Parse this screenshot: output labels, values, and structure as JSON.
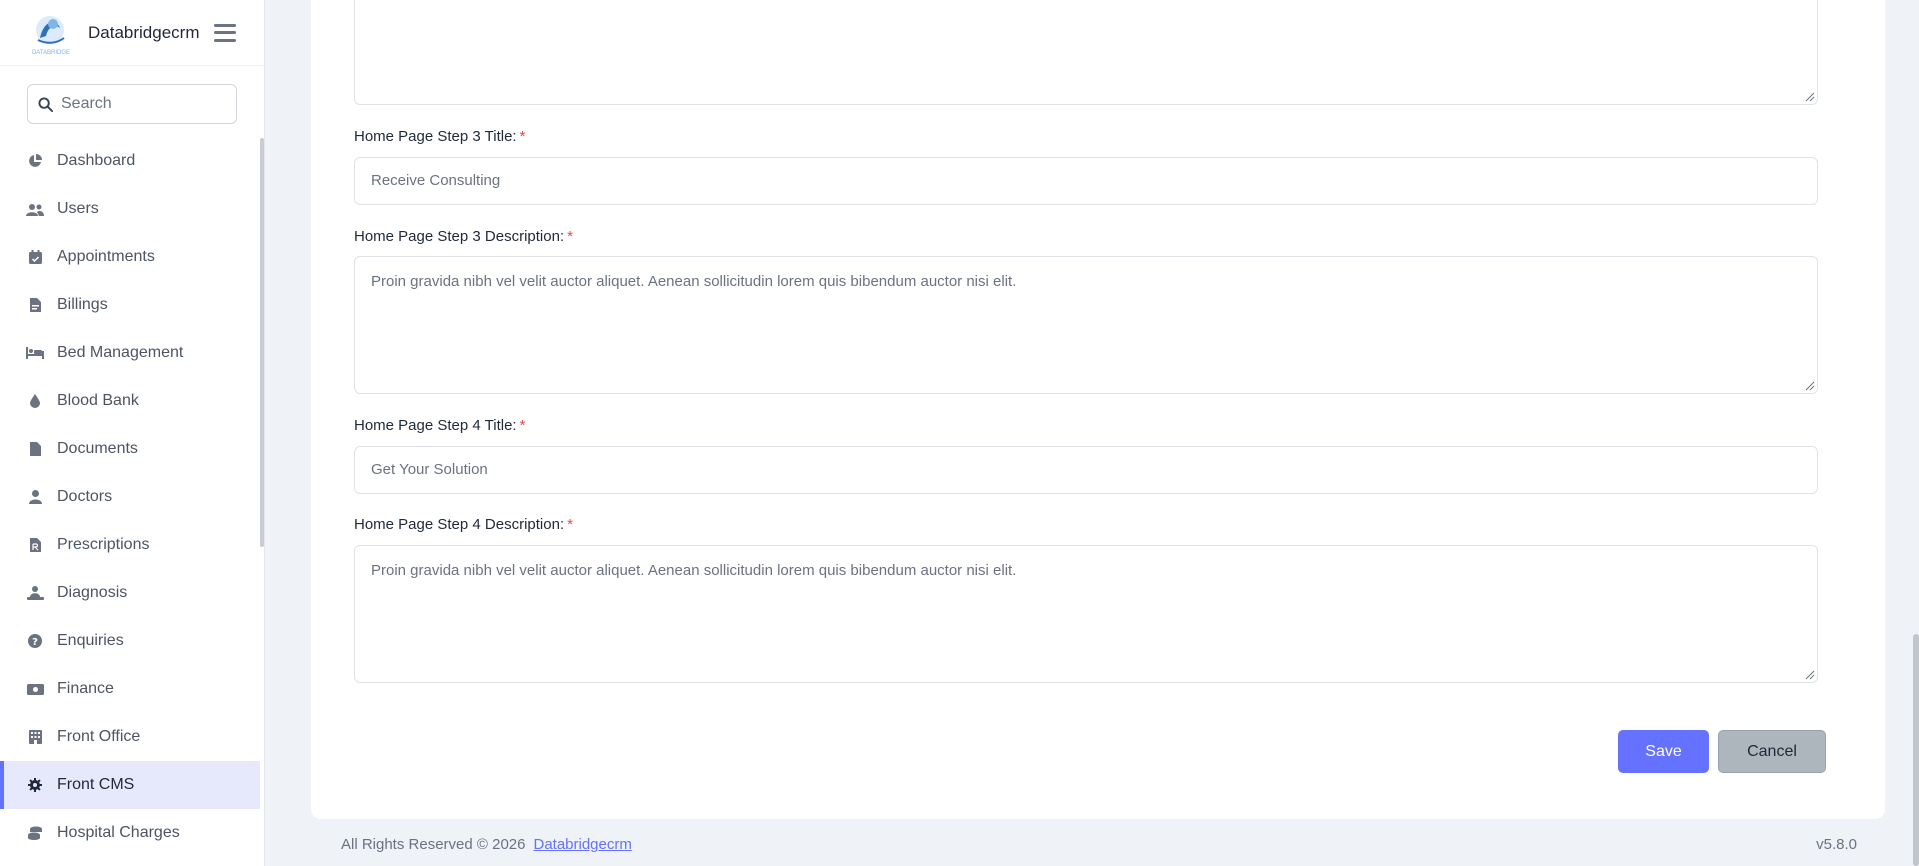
{
  "app": {
    "name": "Databridgecrm",
    "logo_text": "DATABRIDGE"
  },
  "search": {
    "placeholder": "Search"
  },
  "sidebar": {
    "items": [
      {
        "label": "Dashboard",
        "icon": "chart-pie-icon"
      },
      {
        "label": "Users",
        "icon": "users-icon"
      },
      {
        "label": "Appointments",
        "icon": "calendar-check-icon"
      },
      {
        "label": "Billings",
        "icon": "file-invoice-icon"
      },
      {
        "label": "Bed Management",
        "icon": "bed-icon"
      },
      {
        "label": "Blood Bank",
        "icon": "droplet-icon"
      },
      {
        "label": "Documents",
        "icon": "file-icon"
      },
      {
        "label": "Doctors",
        "icon": "user-doctor-icon"
      },
      {
        "label": "Prescriptions",
        "icon": "file-prescription-icon"
      },
      {
        "label": "Diagnosis",
        "icon": "person-diagnosis-icon"
      },
      {
        "label": "Enquiries",
        "icon": "question-circle-icon"
      },
      {
        "label": "Finance",
        "icon": "money-bill-icon"
      },
      {
        "label": "Front Office",
        "icon": "building-icon"
      },
      {
        "label": "Front CMS",
        "icon": "gear-icon",
        "active": true
      },
      {
        "label": "Hospital Charges",
        "icon": "coins-icon"
      }
    ]
  },
  "form": {
    "step3_title_label": "Home Page Step 3 Title:",
    "step3_title_value": "Receive Consulting",
    "step3_desc_label": "Home Page Step 3 Description:",
    "step3_desc_value": "Proin gravida nibh vel velit auctor aliquet. Aenean sollicitudin lorem quis bibendum auctor nisi elit.",
    "step4_title_label": "Home Page Step 4 Title:",
    "step4_title_value": "Get Your Solution",
    "step4_desc_label": "Home Page Step 4 Description:",
    "step4_desc_value": "Proin gravida nibh vel velit auctor aliquet. Aenean sollicitudin lorem quis bibendum auctor nisi elit.",
    "required_mark": "*",
    "save_label": "Save",
    "cancel_label": "Cancel"
  },
  "footer": {
    "copyright": "All Rights Reserved © 2026",
    "link": "Databridgecrm",
    "version": "v5.8.0"
  },
  "colors": {
    "accent": "#6571ff",
    "required": "#ef4444",
    "active_bg": "#e6e8fc"
  }
}
